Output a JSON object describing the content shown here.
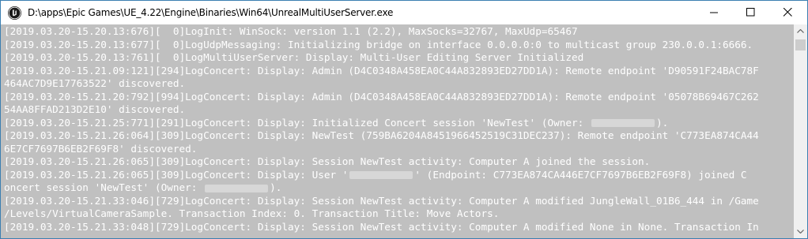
{
  "window": {
    "title": "D:\\apps\\Epic Games\\UE_4.22\\Engine\\Binaries\\Win64\\UnrealMultiUserServer.exe",
    "icon": "unreal-engine-icon",
    "controls": {
      "minimize": "minimize-icon",
      "maximize": "maximize-icon",
      "close": "close-icon"
    }
  },
  "colors": {
    "console_bg": "#c0c0c0",
    "console_text": "#ffffff"
  },
  "console": {
    "lines": [
      "[2019.03.20-15.20.13:676][  0]LogInit: WinSock: version 1.1 (2.2), MaxSocks=32767, MaxUdp=65467",
      "[2019.03.20-15.20.13:677][  0]LogUdpMessaging: Initializing bridge on interface 0.0.0.0:0 to multicast group 230.0.0.1:6666.",
      "[2019.03.20-15.20.13:761][  0]LogMultiUserServer: Display: Multi-User Editing Server Initialized",
      "[2019.03.20-15.21.09:121][294]LogConcert: Display: Admin (D4C0348A458EA0C44A832893ED27DD1A): Remote endpoint 'D90591F24BAC78F",
      "464AC7D9E17763522' discovered.",
      "[2019.03.20-15.21.20:792][994]LogConcert: Display: Admin (D4C0348A458EA0C44A832893ED27DD1A): Remote endpoint '05078B69467C262",
      "54AA8FFAD213D2E10' discovered.",
      "[2019.03.20-15.21.25:771][291]LogConcert: Display: Initialized Concert session 'NewTest' (Owner: ",
      "[2019.03.20-15.21.26:064][309]LogConcert: Display: NewTest (759BA6204A8451966452519C31DEC237): Remote endpoint 'C773EA874CA44",
      "6E7CF7697B6EB2F69F8' discovered.",
      "[2019.03.20-15.21.26:065][309]LogConcert: Display: Session NewTest activity: Computer A joined the session.",
      "[2019.03.20-15.21.26:065][309]LogConcert: Display: User '",
      "oncert session 'NewTest' (Owner: ",
      "[2019.03.20-15.21.33:046][729]LogConcert: Display: Session NewTest activity: Computer A modified JungleWall_01B6_444 in /Game",
      "/Levels/VirtualCameraSample. Transaction Index: 0. Transaction Title: Move Actors.",
      "[2019.03.20-15.21.33:048][729]LogConcert: Display: Session NewTest activity: Computer A modified None in None. Transaction In"
    ],
    "line7_suffix": ").",
    "line11_suffix": "' (Endpoint: C773EA874CA446E7CF7697B6EB2F69F8) joined C",
    "line12_suffix": ")."
  },
  "scrollbar": {
    "up": "scroll-up-arrow-icon",
    "down": "scroll-down-arrow-icon",
    "position": 0.0
  }
}
